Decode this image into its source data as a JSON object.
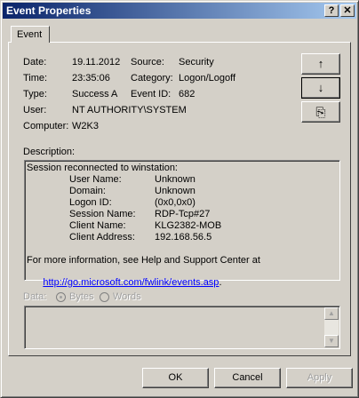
{
  "window": {
    "title": "Event Properties",
    "help_glyph": "?",
    "close_glyph": "✕"
  },
  "tabs": [
    {
      "label": "Event"
    }
  ],
  "fields": {
    "date_label": "Date:",
    "date": "19.11.2012",
    "time_label": "Time:",
    "time": "23:35:06",
    "type_label": "Type:",
    "type": "Success A",
    "user_label": "User:",
    "user": "NT AUTHORITY\\SYSTEM",
    "computer_label": "Computer:",
    "computer": "W2K3",
    "source_label": "Source:",
    "source": "Security",
    "category_label": "Category:",
    "category": "Logon/Logoff",
    "event_id_label": "Event ID:",
    "event_id": "682"
  },
  "nav_buttons": {
    "up": "↑",
    "down": "↓",
    "copy": "⎘"
  },
  "description": {
    "label": "Description:",
    "intro": "Session reconnected to winstation:",
    "rows": [
      {
        "key": "User Name:",
        "value": "Unknown"
      },
      {
        "key": "Domain:",
        "value": "Unknown"
      },
      {
        "key": "Logon ID:",
        "value": "(0x0,0x0)"
      },
      {
        "key": "Session Name:",
        "value": "RDP-Tcp#27"
      },
      {
        "key": "Client Name:",
        "value": "KLG2382-MOB"
      },
      {
        "key": "Client Address:",
        "value": "192.168.56.5"
      }
    ],
    "more_info": "For more information, see Help and Support Center at",
    "link": "http://go.microsoft.com/fwlink/events.asp",
    "link_suffix": "."
  },
  "data_section": {
    "label": "Data:",
    "bytes": "Bytes",
    "words": "Words",
    "selected": "Bytes"
  },
  "buttons": {
    "ok": "OK",
    "cancel": "Cancel",
    "apply": "Apply"
  },
  "colors": {
    "title_start": "#0a246a",
    "title_end": "#a6caf0",
    "face": "#d4d0c8",
    "link": "#0000ff"
  }
}
